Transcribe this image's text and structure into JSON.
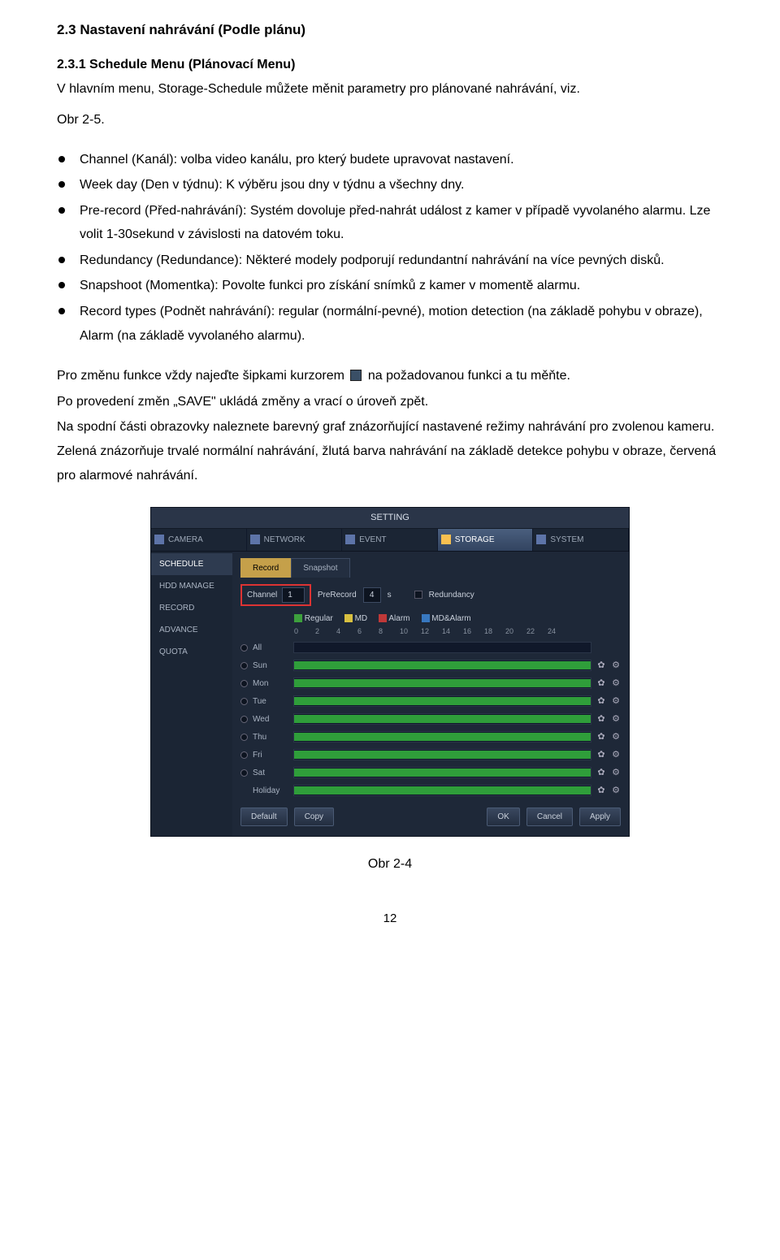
{
  "heading": "2.3  Nastavení nahrávání (Podle plánu)",
  "subheading": "2.3.1  Schedule Menu (Plánovací Menu)",
  "intro": "V hlavním menu, Storage-Schedule můžete měnit parametry pro plánované nahrávání, viz.",
  "figref_top": "Obr 2-5.",
  "bullets": [
    "Channel (Kanál): volba video kanálu, pro který budete upravovat nastavení.",
    "Week day (Den v týdnu): K výběru jsou dny v týdnu a všechny dny.",
    "Pre-record (Před-nahrávání): Systém dovoluje před-nahrát událost z kamer v případě vyvolaného alarmu. Lze volit 1-30sekund v závislosti na datovém toku.",
    "Redundancy (Redundance): Některé modely podporují redundantní nahrávání na více pevných disků.",
    "Snapshoot (Momentka): Povolte funkci pro získání snímků z kamer v momentě alarmu.",
    "Record types (Podnět nahrávání): regular (normální-pevné), motion detection (na základě pohybu v obraze), Alarm (na základě vyvolaného alarmu)."
  ],
  "para1_a": "Pro změnu funkce vždy najeďte šipkami kurzorem",
  "para1_b": "na požadovanou funkci a tu měňte.",
  "para2": "Po provedení změn „SAVE\" ukládá změny a vrací o úroveň zpět.",
  "para3": "Na spodní části obrazovky naleznete barevný graf znázorňující nastavené režimy nahrávání pro zvolenou kameru. Zelená znázorňuje trvalé normální nahrávání, žlutá barva nahrávání na základě detekce pohybu v obraze, červená pro alarmové nahrávání.",
  "screenshot": {
    "title": "SETTING",
    "tabs": [
      "CAMERA",
      "NETWORK",
      "EVENT",
      "STORAGE",
      "SYSTEM"
    ],
    "active_tab": "STORAGE",
    "sidebar": [
      "SCHEDULE",
      "HDD MANAGE",
      "RECORD",
      "ADVANCE",
      "QUOTA"
    ],
    "active_side": "SCHEDULE",
    "subtabs": [
      "Record",
      "Snapshot"
    ],
    "active_subtab": "Record",
    "channel_label": "Channel",
    "channel_value": "1",
    "prerecord_label": "PreRecord",
    "prerecord_value": "4",
    "prerecord_unit": "s",
    "redundancy_label": "Redundancy",
    "types": [
      {
        "label": "Regular",
        "color": "green"
      },
      {
        "label": "MD",
        "color": "yellow"
      },
      {
        "label": "Alarm",
        "color": "red"
      },
      {
        "label": "MD&Alarm",
        "color": "blue"
      }
    ],
    "axis": [
      "0",
      "2",
      "4",
      "6",
      "8",
      "10",
      "12",
      "14",
      "16",
      "18",
      "20",
      "22",
      "24"
    ],
    "days": [
      "All",
      "Sun",
      "Mon",
      "Tue",
      "Wed",
      "Thu",
      "Fri",
      "Sat",
      "Holiday"
    ],
    "buttons_left": [
      "Default",
      "Copy"
    ],
    "buttons_right": [
      "OK",
      "Cancel",
      "Apply"
    ]
  },
  "fig_caption": "Obr 2-4",
  "page_number": "12"
}
